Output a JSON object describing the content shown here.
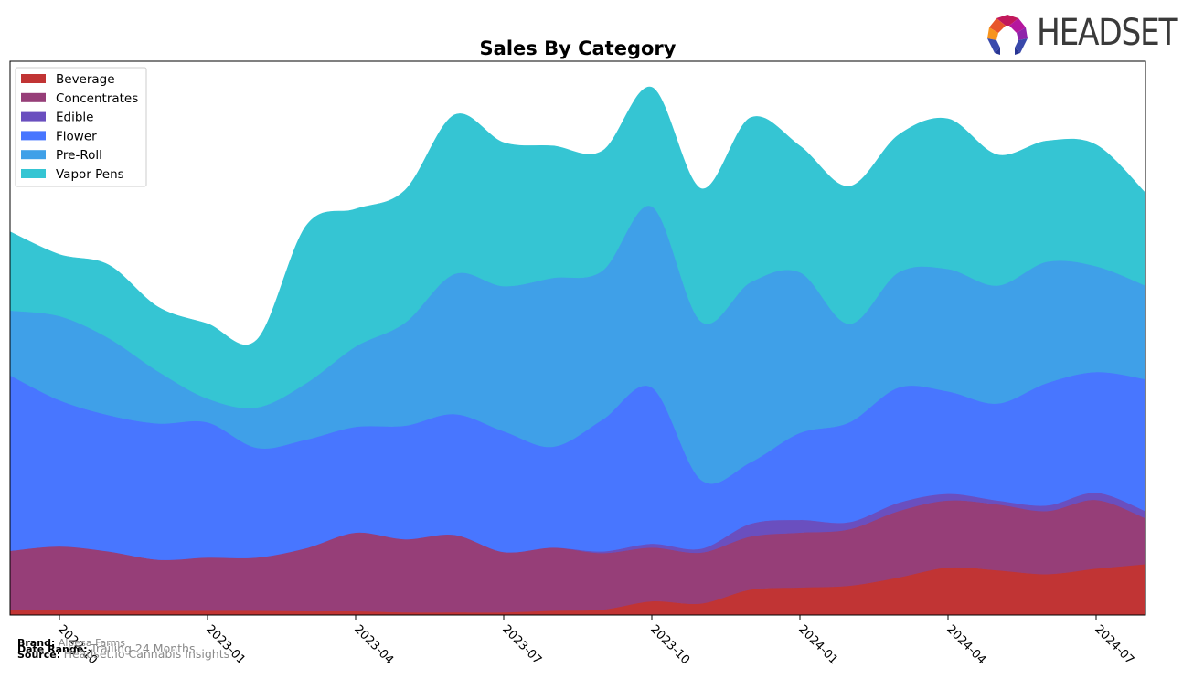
{
  "header": {
    "brand_logo_text": "HEADSET",
    "logo_icon": "headset-logo-icon"
  },
  "footer": {
    "brand_label": "Brand:",
    "brand_value": "Alpesa Farms",
    "date_range_label": "Date Range:",
    "date_range_value": "Trailing 24 Months",
    "source_label": "Source:",
    "source_value": "Headset.io Cannabis Insights"
  },
  "chart_data": {
    "type": "area",
    "stacked": true,
    "smooth": true,
    "title": "Sales By Category",
    "xlabel": "",
    "ylabel": "",
    "y_axis_visible": false,
    "y_units": "relative share of plot height (0-100), no y-axis shown",
    "ylim": [
      0,
      100
    ],
    "grid": false,
    "legend_position": "top-left",
    "x": [
      "2022-09",
      "2022-10",
      "2022-11",
      "2022-12",
      "2023-01",
      "2023-02",
      "2023-03",
      "2023-04",
      "2023-05",
      "2023-06",
      "2023-07",
      "2023-08",
      "2023-09",
      "2023-10",
      "2023-11",
      "2023-12",
      "2024-01",
      "2024-02",
      "2024-03",
      "2024-04",
      "2024-05",
      "2024-06",
      "2024-07",
      "2024-08"
    ],
    "xticks": [
      "2022-10",
      "2023-01",
      "2023-04",
      "2023-07",
      "2023-10",
      "2024-01",
      "2024-04",
      "2024-07"
    ],
    "series": [
      {
        "name": "Beverage",
        "color": "#c13434",
        "values": [
          1.0,
          1.0,
          0.8,
          0.8,
          0.8,
          0.8,
          0.7,
          0.7,
          0.5,
          0.5,
          0.5,
          0.8,
          1.0,
          2.5,
          2.1,
          4.6,
          5.0,
          5.3,
          6.8,
          8.6,
          8.1,
          7.4,
          8.4,
          9.2
        ]
      },
      {
        "name": "Concentrates",
        "color": "#963e78",
        "values": [
          10.6,
          11.4,
          10.7,
          9.2,
          9.6,
          9.6,
          11.4,
          14.2,
          13.2,
          14.0,
          10.9,
          11.4,
          10.2,
          9.7,
          9.2,
          9.6,
          9.9,
          10.2,
          12.0,
          12.1,
          11.9,
          11.4,
          12.4,
          8.3
        ]
      },
      {
        "name": "Edible",
        "color": "#6a4fbf",
        "values": [
          0.0,
          0.0,
          0.0,
          0.0,
          0.0,
          0.0,
          0.0,
          0.0,
          0.0,
          0.0,
          0.0,
          0.0,
          0.3,
          0.7,
          0.7,
          2.3,
          2.3,
          1.3,
          1.5,
          1.2,
          0.7,
          1.0,
          1.3,
          1.3
        ]
      },
      {
        "name": "Flower",
        "color": "#4876ff",
        "values": [
          31.7,
          26.4,
          24.6,
          24.6,
          24.4,
          19.8,
          19.6,
          19.1,
          20.5,
          21.8,
          21.8,
          18.2,
          23.8,
          28.2,
          12.4,
          11.1,
          15.7,
          18.0,
          20.8,
          18.5,
          17.5,
          22.1,
          21.8,
          23.8
        ]
      },
      {
        "name": "Pre-Roll",
        "color": "#3fa0e8",
        "values": [
          11.7,
          15.2,
          13.9,
          9.4,
          4.3,
          7.3,
          10.2,
          14.5,
          18.6,
          25.3,
          26.2,
          30.5,
          26.9,
          32.7,
          28.6,
          32.5,
          29.0,
          17.8,
          20.8,
          22.1,
          21.3,
          21.9,
          19.1,
          16.9
        ]
      },
      {
        "name": "Vapor Pens",
        "color": "#35c5d3",
        "values": [
          14.2,
          11.1,
          13.2,
          11.6,
          13.5,
          12.2,
          28.4,
          24.8,
          23.9,
          28.7,
          25.9,
          23.8,
          21.6,
          21.5,
          24.0,
          29.7,
          22.8,
          24.8,
          24.8,
          27.1,
          23.6,
          21.8,
          21.9,
          16.7
        ]
      }
    ]
  }
}
